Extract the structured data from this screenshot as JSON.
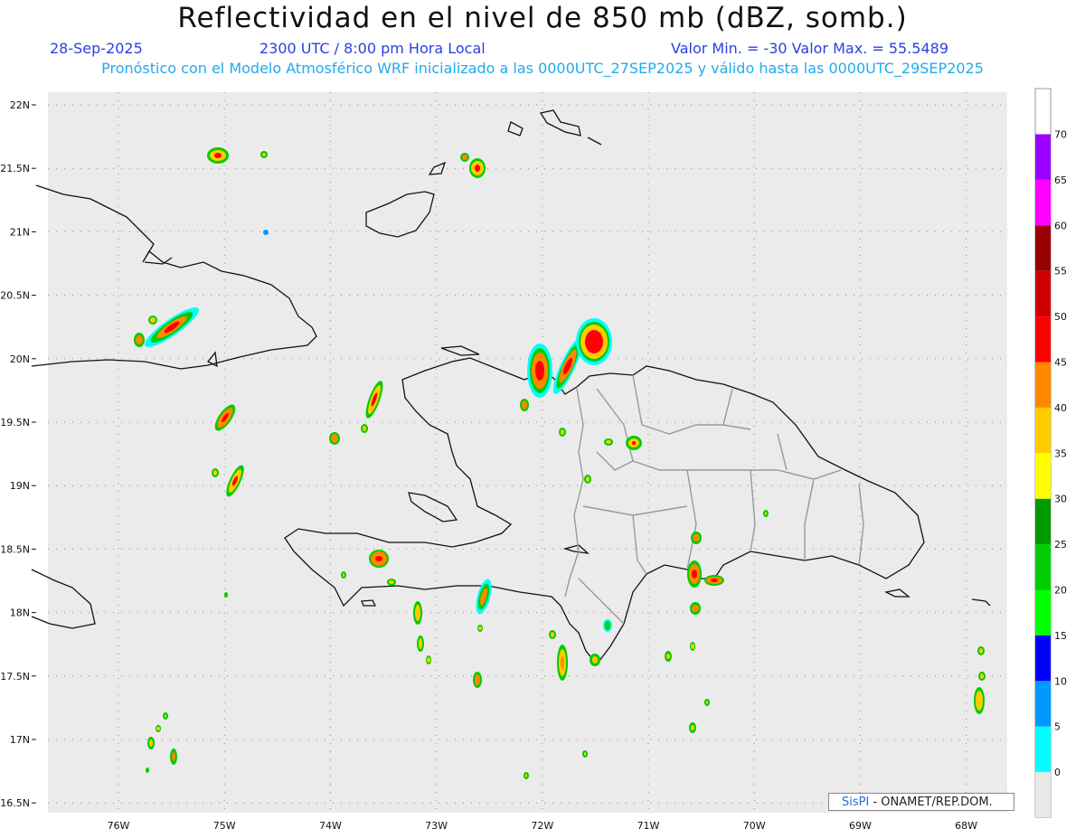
{
  "title": "Reflectividad en el nivel de 850 mb (dBZ, somb.)",
  "date": "28-Sep-2025",
  "time": "2300 UTC / 8:00 pm Hora Local",
  "value_range": "Valor Min. = -30  Valor Max. = 55.5489",
  "model_info": "Pronóstico con el Modelo Atmosférico WRF inicializado a las 0000UTC_27SEP2025 y válido hasta las  0000UTC_29SEP2025",
  "credit": {
    "brand": "SisPI",
    "text": "- ONAMET/REP.DOM."
  },
  "axes": {
    "lat_labels": [
      "22N",
      "21.5N",
      "21N",
      "20.5N",
      "20N",
      "19.5N",
      "19N",
      "18.5N",
      "18N",
      "17.5N",
      "17N",
      "16.5N"
    ],
    "lon_labels": [
      "76W",
      "75W",
      "74W",
      "73W",
      "72W",
      "71W",
      "70W",
      "69W",
      "68W"
    ]
  },
  "colorbar": {
    "labels": [
      "0",
      "5",
      "10",
      "15",
      "20",
      "25",
      "30",
      "35",
      "40",
      "45",
      "50",
      "55",
      "60",
      "65",
      "70"
    ],
    "colors": [
      "#00ffff",
      "#0099ff",
      "#0000ff",
      "#00ff00",
      "#00cc00",
      "#009900",
      "#ffff00",
      "#ffcc00",
      "#ff8800",
      "#ff0000",
      "#cc0000",
      "#990000",
      "#ff00ff",
      "#9900ff"
    ]
  }
}
